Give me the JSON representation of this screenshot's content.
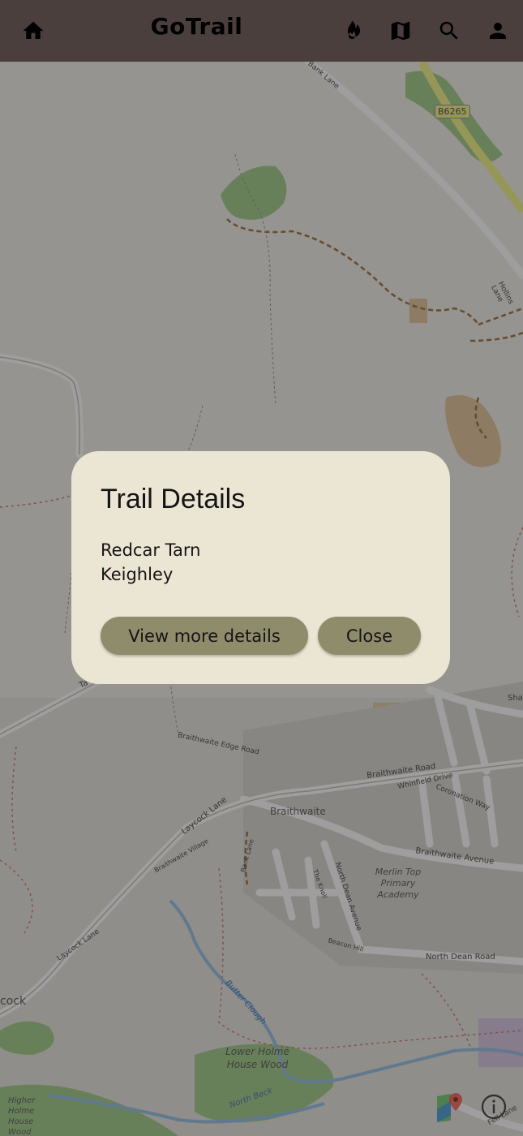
{
  "app": {
    "title": "GoTrail",
    "nav": [
      {
        "icon": "home-icon"
      },
      {
        "icon": "flame-icon"
      },
      {
        "icon": "map-icon"
      },
      {
        "icon": "search-icon"
      },
      {
        "icon": "person-icon"
      }
    ]
  },
  "map": {
    "labels": {
      "road_b6265": "B6265",
      "bank_lane": "Bank Lane",
      "hollins_lane": "Hollins Lane",
      "braithwaite_edge_road": "Braithwaite Edge Road",
      "braithwaite_road": "Braithwaite Road",
      "whinfield_drive": "Whinfield Drive",
      "coronation_way": "Coronation Way",
      "braithwaite": "Braithwaite",
      "laycock_lane": "Laycock Lane",
      "braithwaite_village": "Braithwaite Village",
      "bank_lane_2": "Bank Lane",
      "the_knoll": "The Knoll",
      "north_dean_avenue": "North Dean Avenue",
      "beacon_hill": "Beacon Hill",
      "braithwaite_avenue": "Braithwaite Avenue",
      "school": "Merlin Top Primary Academy",
      "laycock_lane_2": "Laycock Lane",
      "north_dean_road": "North Dean Road",
      "butter_clough": "Butter Clough",
      "lower_holme_house_wood": "Lower Holme House Wood",
      "north_beck": "North Beck",
      "higher_holme_house_wood": "Higher Holme House Wood",
      "laycock": "cock",
      "fell_lane": "Fell Lane",
      "sha": "Sha",
      "ta": "Ta"
    },
    "controls": {
      "maps_icon": "google-maps-icon",
      "info_icon": "info-icon"
    }
  },
  "dialog": {
    "title": "Trail Details",
    "trail_name": "Redcar Tarn",
    "location": "Keighley",
    "view_more_label": "View more details",
    "close_label": "Close"
  }
}
